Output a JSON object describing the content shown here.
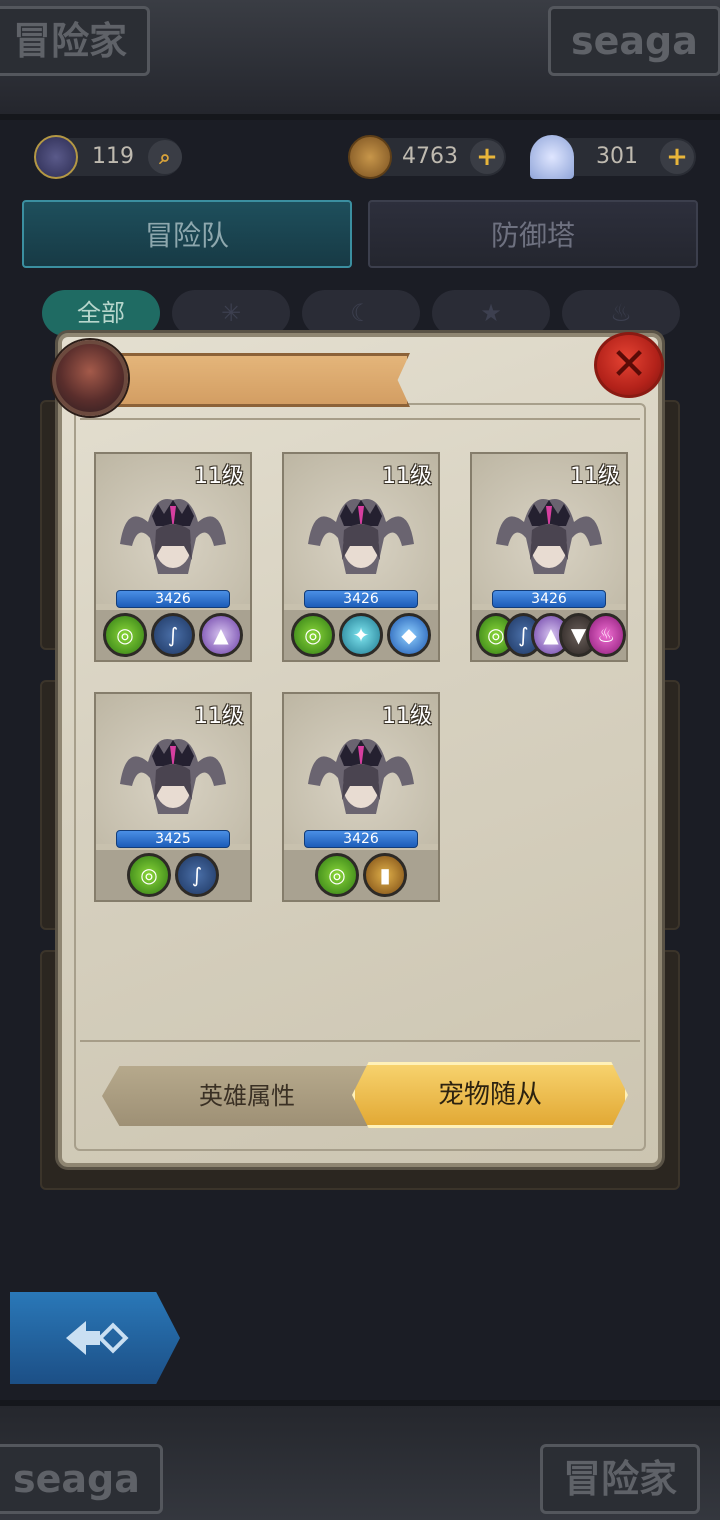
{
  "banners": {
    "top_left": "冒险家",
    "top_right": "seaga",
    "bottom_left": "seaga",
    "bottom_right": "冒险家"
  },
  "resources": {
    "level": "119",
    "gold": "4763",
    "shells": "301"
  },
  "main_tabs": [
    "冒险队",
    "防御塔"
  ],
  "filters": [
    "全部",
    "✳",
    "☾",
    "★",
    "♨"
  ],
  "pets": [
    {
      "level": "11级",
      "power": "3426",
      "equips": [
        "amulet",
        "whip",
        "helmet"
      ]
    },
    {
      "level": "11级",
      "power": "3426",
      "equips": [
        "amulet",
        "crossbow",
        "shield"
      ]
    },
    {
      "level": "11级",
      "power": "3426",
      "equips": [
        "amulet",
        "whip",
        "helmet",
        "hat",
        "flame"
      ]
    },
    {
      "level": "11级",
      "power": "3425",
      "equips": [
        "amulet",
        "whip"
      ]
    },
    {
      "level": "11级",
      "power": "3426",
      "equips": [
        "amulet",
        "boots"
      ]
    }
  ],
  "bottom_tabs": {
    "hero_attributes": "英雄属性",
    "pet_followers": "宠物随从"
  },
  "colors": {
    "accent_gold": "#e2a935",
    "close_red": "#c0271c",
    "power_blue": "#1c5cb8",
    "tab_active": "#1e4f5c"
  }
}
